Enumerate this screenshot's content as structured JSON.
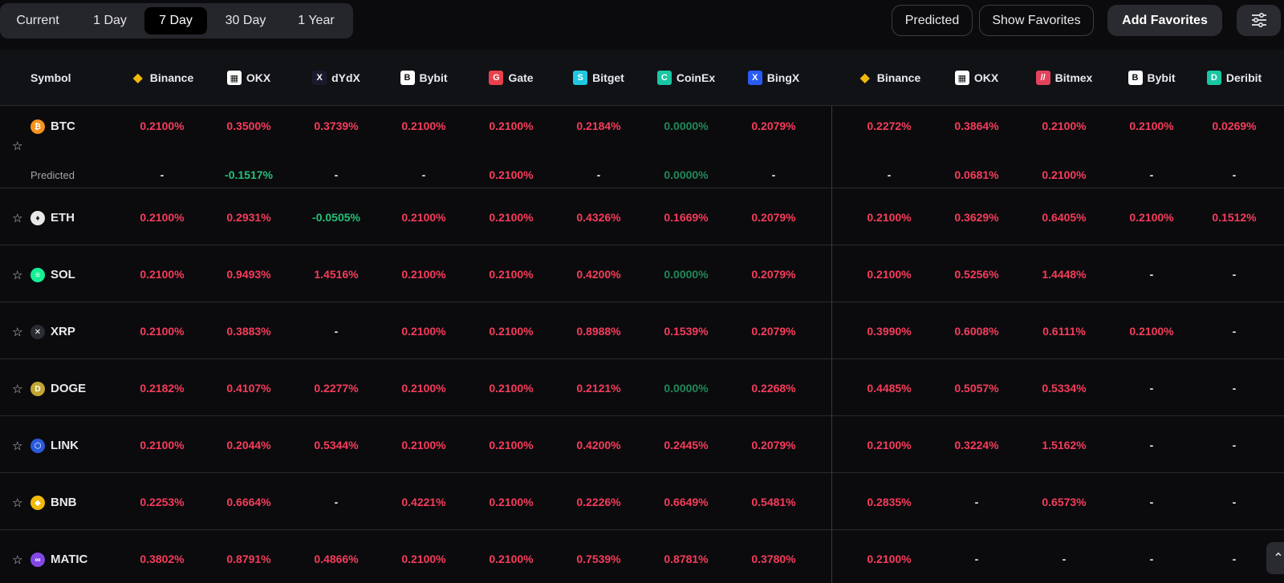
{
  "tabs": [
    "Current",
    "1 Day",
    "7 Day",
    "30 Day",
    "1 Year"
  ],
  "active_tab": "7 Day",
  "toolbar": {
    "predicted_label": "Predicted",
    "show_favorites_label": "Show Favorites",
    "add_favorites_label": "Add Favorites",
    "settings_icon": "sliders-icon"
  },
  "header": {
    "symbol_label": "Symbol",
    "exchanges": [
      {
        "name": "Binance",
        "icon": "binance-icon",
        "color": "#f0b90b"
      },
      {
        "name": "OKX",
        "icon": "okx-icon",
        "color": "#ffffff"
      },
      {
        "name": "dYdX",
        "icon": "dydx-icon",
        "color": "#1a1a2e"
      },
      {
        "name": "Bybit",
        "icon": "bybit-icon",
        "color": "#ffffff"
      },
      {
        "name": "Gate",
        "icon": "gate-icon",
        "color": "#e8414b"
      },
      {
        "name": "Bitget",
        "icon": "bitget-icon",
        "color": "#1ec8e0"
      },
      {
        "name": "CoinEx",
        "icon": "coinex-icon",
        "color": "#19c6a3"
      },
      {
        "name": "BingX",
        "icon": "bingx-icon",
        "color": "#2a5bf5"
      },
      {
        "name": "Binance",
        "icon": "binance-icon",
        "color": "#f0b90b"
      },
      {
        "name": "OKX",
        "icon": "okx-icon",
        "color": "#ffffff"
      },
      {
        "name": "Bitmex",
        "icon": "bitmex-icon",
        "color": "#e2435c"
      },
      {
        "name": "Bybit",
        "icon": "bybit-icon",
        "color": "#ffffff"
      },
      {
        "name": "Deribit",
        "icon": "deribit-icon",
        "color": "#19c6a3"
      }
    ]
  },
  "predicted_row_label": "Predicted",
  "rows": [
    {
      "symbol": "BTC",
      "icon": "bitcoin-icon",
      "color": "#f7931a",
      "values": [
        "0.2100%",
        "0.3500%",
        "0.3739%",
        "0.2100%",
        "0.2100%",
        "0.2184%",
        "0.0000%",
        "0.2079%",
        "0.2272%",
        "0.3864%",
        "0.2100%",
        "0.2100%",
        "0.0269%"
      ],
      "predicted": [
        "-",
        "-0.1517%",
        "-",
        "-",
        "0.2100%",
        "-",
        "0.0000%",
        "-",
        "-",
        "0.0681%",
        "0.2100%",
        "-",
        "-"
      ]
    },
    {
      "symbol": "ETH",
      "icon": "ethereum-icon",
      "color": "#e8e8e8",
      "values": [
        "0.2100%",
        "0.2931%",
        "-0.0505%",
        "0.2100%",
        "0.2100%",
        "0.4326%",
        "0.1669%",
        "0.2079%",
        "0.2100%",
        "0.3629%",
        "0.6405%",
        "0.2100%",
        "0.1512%"
      ]
    },
    {
      "symbol": "SOL",
      "icon": "solana-icon",
      "color": "#14f195",
      "values": [
        "0.2100%",
        "0.9493%",
        "1.4516%",
        "0.2100%",
        "0.2100%",
        "0.4200%",
        "0.0000%",
        "0.2079%",
        "0.2100%",
        "0.5256%",
        "1.4448%",
        "-",
        "-"
      ]
    },
    {
      "symbol": "XRP",
      "icon": "xrp-icon",
      "color": "#2b2c33",
      "values": [
        "0.2100%",
        "0.3883%",
        "-",
        "0.2100%",
        "0.2100%",
        "0.8988%",
        "0.1539%",
        "0.2079%",
        "0.3990%",
        "0.6008%",
        "0.6111%",
        "0.2100%",
        "-"
      ]
    },
    {
      "symbol": "DOGE",
      "icon": "doge-icon",
      "color": "#c2a633",
      "values": [
        "0.2182%",
        "0.4107%",
        "0.2277%",
        "0.2100%",
        "0.2100%",
        "0.2121%",
        "0.0000%",
        "0.2268%",
        "0.4485%",
        "0.5057%",
        "0.5334%",
        "-",
        "-"
      ]
    },
    {
      "symbol": "LINK",
      "icon": "chainlink-icon",
      "color": "#2a5ada",
      "values": [
        "0.2100%",
        "0.2044%",
        "0.5344%",
        "0.2100%",
        "0.2100%",
        "0.4200%",
        "0.2445%",
        "0.2079%",
        "0.2100%",
        "0.3224%",
        "1.5162%",
        "-",
        "-"
      ]
    },
    {
      "symbol": "BNB",
      "icon": "bnb-icon",
      "color": "#f0b90b",
      "values": [
        "0.2253%",
        "0.6664%",
        "-",
        "0.4221%",
        "0.2100%",
        "0.2226%",
        "0.6649%",
        "0.5481%",
        "0.2835%",
        "-",
        "0.6573%",
        "-",
        "-"
      ]
    },
    {
      "symbol": "MATIC",
      "icon": "polygon-icon",
      "color": "#8247e5",
      "values": [
        "0.3802%",
        "0.8791%",
        "0.4866%",
        "0.2100%",
        "0.2100%",
        "0.7539%",
        "0.8781%",
        "0.3780%",
        "0.2100%",
        "-",
        "-",
        "-",
        "-"
      ]
    }
  ],
  "colors": {
    "negative_rate": "#f63c5a",
    "positive_rate": "#24c178",
    "zero_rate": "#1f8a58"
  },
  "scroll_up_icon": "chevron-up-icon"
}
